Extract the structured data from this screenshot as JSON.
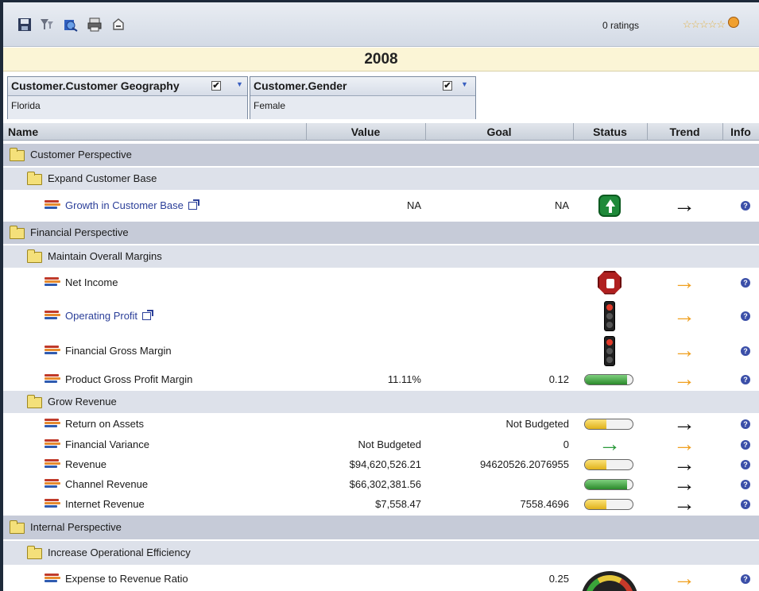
{
  "toolbar": {
    "ratings_text": "0 ratings",
    "icons": [
      "save-icon",
      "filter-icon",
      "export-icon",
      "print-icon",
      "bookmark-icon"
    ]
  },
  "year": "2008",
  "filters": [
    {
      "title": "Customer.Customer Geography",
      "value": "Florida",
      "checked": true
    },
    {
      "title": "Customer.Gender",
      "value": "Female",
      "checked": true
    }
  ],
  "columns": {
    "name": "Name",
    "value": "Value",
    "goal": "Goal",
    "status": "Status",
    "trend": "Trend",
    "info": "Info"
  },
  "rows": [
    {
      "type": "group",
      "name": "Customer Perspective"
    },
    {
      "type": "sub",
      "name": "Expand Customer Base"
    },
    {
      "type": "item",
      "name": "Growth in Customer Base",
      "link": true,
      "value": "NA",
      "goal": "NA",
      "status": "green-up-arrow",
      "trend": "right-black"
    },
    {
      "type": "group",
      "name": "Financial Perspective"
    },
    {
      "type": "sub",
      "name": "Maintain Overall Margins"
    },
    {
      "type": "item",
      "name": "Net Income",
      "value": "",
      "goal": "",
      "status": "stop-sign",
      "trend": "right-orange"
    },
    {
      "type": "item",
      "name": "Operating Profit",
      "link": true,
      "value": "",
      "goal": "",
      "status": "traffic-light-red",
      "trend": "right-orange"
    },
    {
      "type": "item",
      "name": "Financial Gross Margin",
      "value": "",
      "goal": "",
      "status": "traffic-light-red",
      "trend": "right-orange"
    },
    {
      "type": "item",
      "name": "Product Gross Profit Margin",
      "value": "11.11%",
      "goal": "0.12",
      "status": "gauge-green",
      "trend": "right-orange"
    },
    {
      "type": "sub",
      "name": "Grow Revenue"
    },
    {
      "type": "item",
      "name": "Return on Assets",
      "value": "",
      "goal": "Not Budgeted",
      "status": "gauge-yellow",
      "trend": "right-black"
    },
    {
      "type": "item",
      "name": "Financial Variance",
      "value": "Not Budgeted",
      "goal": "0",
      "status": "green-right-arrow",
      "trend": "right-orange"
    },
    {
      "type": "item",
      "name": "Revenue",
      "value": "$94,620,526.21",
      "goal": "94620526.2076955",
      "status": "gauge-yellow",
      "trend": "right-black"
    },
    {
      "type": "item",
      "name": "Channel Revenue",
      "value": "$66,302,381.56",
      "goal": "",
      "status": "gauge-green",
      "trend": "right-black"
    },
    {
      "type": "item",
      "name": "Internet Revenue",
      "value": "$7,558.47",
      "goal": "7558.4696",
      "status": "gauge-yellow",
      "trend": "right-black"
    },
    {
      "type": "group",
      "name": "Internal Perspective"
    },
    {
      "type": "sub",
      "name": "Increase Operational Efficiency"
    },
    {
      "type": "item",
      "name": "Expense to Revenue Ratio",
      "value": "",
      "goal": "0.25",
      "status": "speedometer",
      "trend": "right-orange"
    }
  ],
  "colors": {
    "group_bg": "#c6cbd8",
    "sub_bg": "#dde1ea",
    "year_bg": "#fbf5d6",
    "link": "#2b3f99"
  }
}
